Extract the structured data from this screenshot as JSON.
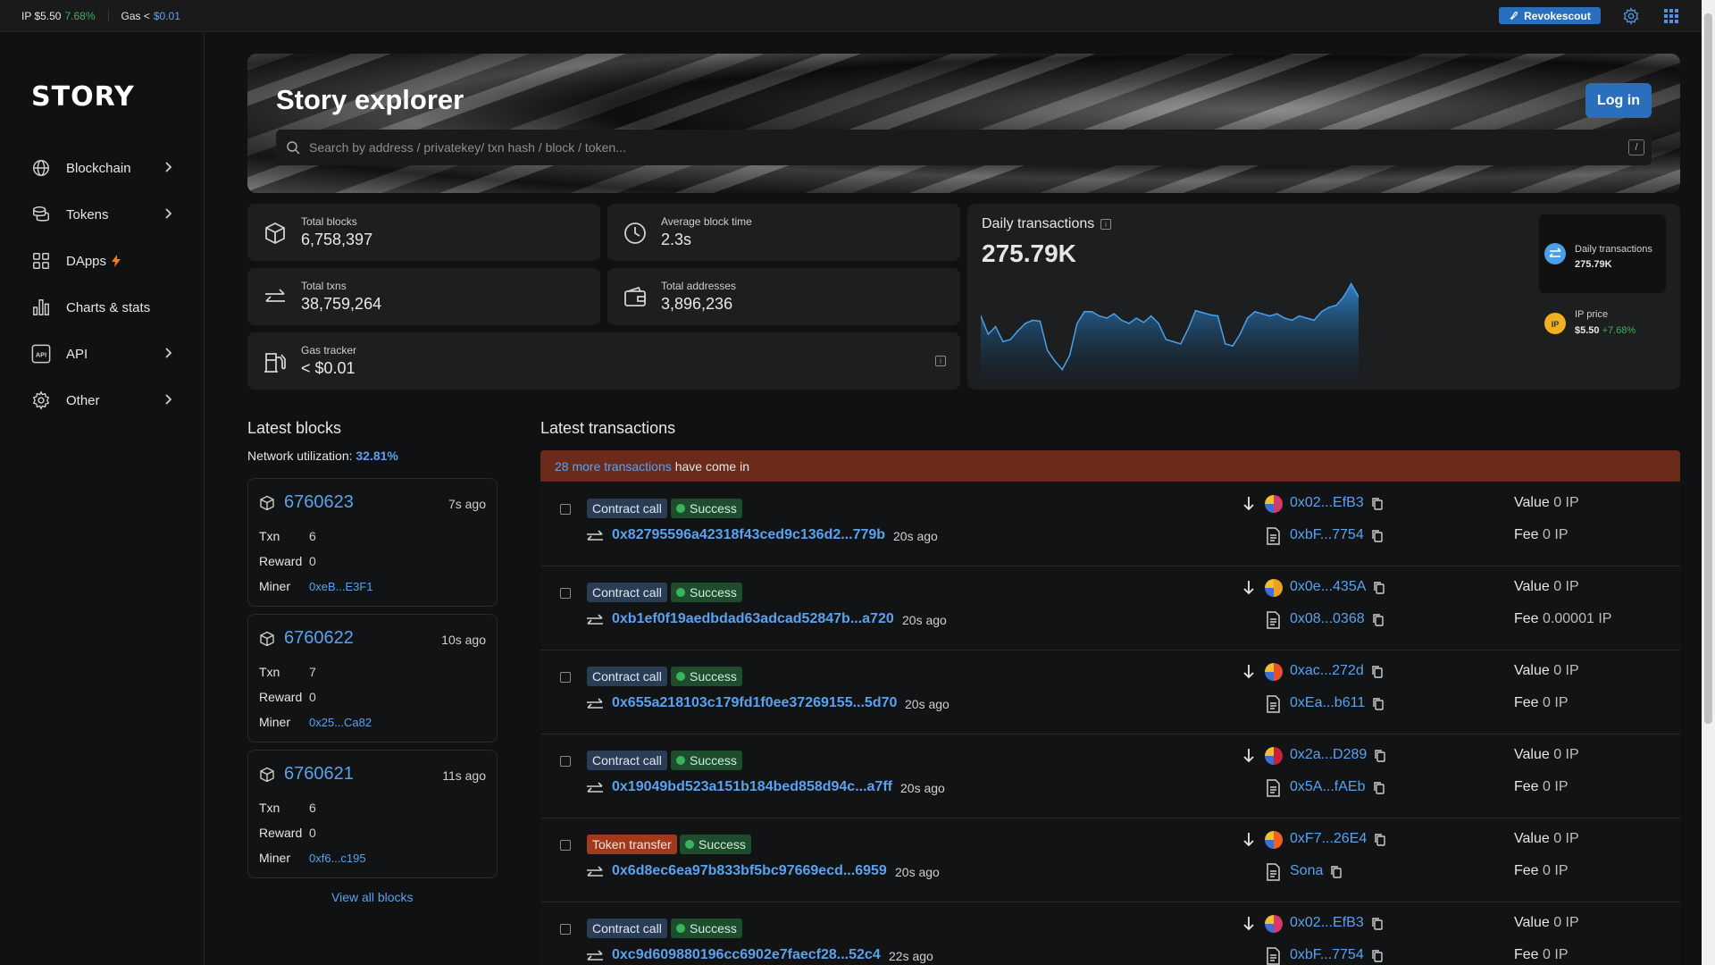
{
  "topbar": {
    "ip_label": "IP $5.50",
    "ip_change": "7.68%",
    "gas_label": "Gas <",
    "gas_value": "$0.01",
    "revoke_label": "Revokescout"
  },
  "sidebar": {
    "logo": "STORY",
    "items": [
      {
        "label": "Blockchain",
        "icon": "globe-icon",
        "has_chevron": true
      },
      {
        "label": "Tokens",
        "icon": "coins-icon",
        "has_chevron": true
      },
      {
        "label": "DApps",
        "icon": "grid-icon",
        "has_chevron": false
      },
      {
        "label": "Charts & stats",
        "icon": "bar-chart-icon",
        "has_chevron": false
      },
      {
        "label": "API",
        "icon": "api-icon",
        "has_chevron": true
      },
      {
        "label": "Other",
        "icon": "gear-icon",
        "has_chevron": true
      }
    ]
  },
  "hero": {
    "title": "Story explorer",
    "login_label": "Log in",
    "search_placeholder": "Search by address / privatekey/ txn hash / block / token...",
    "slash_hint": "/"
  },
  "stats": {
    "total_blocks": {
      "label": "Total blocks",
      "value": "6,758,397"
    },
    "avg_block_time": {
      "label": "Average block time",
      "value": "2.3s"
    },
    "total_txns": {
      "label": "Total txns",
      "value": "38,759,264"
    },
    "total_addresses": {
      "label": "Total addresses",
      "value": "3,896,236"
    },
    "gas_tracker": {
      "label": "Gas tracker",
      "value": "< $0.01"
    }
  },
  "daily": {
    "title": "Daily transactions",
    "value": "275.79K",
    "side_label": "Daily transactions",
    "side_value": "275.79K",
    "ip_price_label": "IP price",
    "ip_price_value": "$5.50",
    "ip_price_change": "+7.68%"
  },
  "chart_data": {
    "type": "area",
    "values": [
      62,
      45,
      52,
      38,
      40,
      48,
      55,
      58,
      57,
      30,
      20,
      12,
      25,
      55,
      66,
      66,
      62,
      60,
      64,
      58,
      55,
      60,
      56,
      62,
      55,
      40,
      38,
      36,
      50,
      67,
      65,
      63,
      62,
      36,
      34,
      45,
      60,
      66,
      64,
      62,
      64,
      60,
      58,
      62,
      60,
      58,
      66,
      70,
      72,
      80,
      92,
      80
    ],
    "colors": {
      "fill_top": "#2e7fc4",
      "fill_bottom": "#0f2233",
      "stroke": "#4aa0e8"
    }
  },
  "blocks": {
    "title": "Latest blocks",
    "util_label": "Network utilization:",
    "util_value": "32.81%",
    "view_all": "View all blocks",
    "labels": {
      "txn": "Txn",
      "reward": "Reward",
      "miner": "Miner"
    },
    "items": [
      {
        "number": "6760623",
        "ago": "7s ago",
        "txn": "6",
        "reward": "0",
        "miner": "0xeB...E3F1"
      },
      {
        "number": "6760622",
        "ago": "10s ago",
        "txn": "7",
        "reward": "0",
        "miner": "0x25...Ca82"
      },
      {
        "number": "6760621",
        "ago": "11s ago",
        "txn": "6",
        "reward": "0",
        "miner": "0xf6...c195"
      }
    ]
  },
  "txs": {
    "title": "Latest transactions",
    "alert_link": "28 more transactions",
    "alert_text": "have come in",
    "success_label": "Success",
    "value_label": "Value",
    "fee_label": "Fee",
    "items": [
      {
        "type": "Contract call",
        "hash": "0x82795596a42318f43ced9c136d2...779b",
        "ago": "20s ago",
        "from": "0x02...EfB3",
        "to": "0xbF...7754",
        "value": "0 IP",
        "fee": "0 IP",
        "avatar": "#d43a6a"
      },
      {
        "type": "Contract call",
        "hash": "0xb1ef0f19aedbdad63adcad52847b...a720",
        "ago": "20s ago",
        "from": "0x0e...435A",
        "to": "0x08...0368",
        "value": "0 IP",
        "fee": "0.00001 IP",
        "avatar": "#f0a020"
      },
      {
        "type": "Contract call",
        "hash": "0x655a218103c179fd1f0ee37269155...5d70",
        "ago": "20s ago",
        "from": "0xac...272d",
        "to": "0xEa...b611",
        "value": "0 IP",
        "fee": "0 IP",
        "avatar": "#e8502a"
      },
      {
        "type": "Contract call",
        "hash": "0x19049bd523a151b184bed858d94c...a7ff",
        "ago": "20s ago",
        "from": "0x2a...D289",
        "to": "0x5A...fAEb",
        "value": "0 IP",
        "fee": "0 IP",
        "avatar": "#c8203a"
      },
      {
        "type": "Token transfer",
        "hash": "0x6d8ec6ea97b833bf5bc97669ecd...6959",
        "ago": "20s ago",
        "from": "0xF7...26E4",
        "to": "Sona",
        "value": "0 IP",
        "fee": "0 IP",
        "avatar": "#f06020"
      },
      {
        "type": "Contract call",
        "hash": "0xc9d609880196cc6902e7faecf28...52c4",
        "ago": "22s ago",
        "from": "0x02...EfB3",
        "to": "0xbF...7754",
        "value": "0 IP",
        "fee": "0 IP",
        "avatar": "#d43a6a"
      }
    ]
  }
}
